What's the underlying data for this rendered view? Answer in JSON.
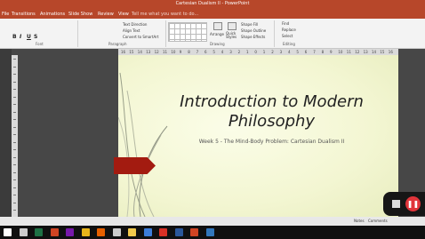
{
  "window": {
    "title": "Cartesian Dualism II - PowerPoint"
  },
  "tabs": [
    {
      "label": "File"
    },
    {
      "label": "Transitions"
    },
    {
      "label": "Animations"
    },
    {
      "label": "Slide Show"
    },
    {
      "label": "Review"
    },
    {
      "label": "View"
    }
  ],
  "tell_me": "Tell me what you want to do...",
  "ribbon": {
    "font_group": "Font",
    "paragraph_group": "Paragraph",
    "drawing_group": "Drawing",
    "editing_group": "Editing",
    "text_direction": "Text Direction",
    "align_text": "Align Text",
    "convert_smartart": "Convert to SmartArt",
    "arrange": "Arrange",
    "quick_styles": "Quick Styles",
    "shape_fill": "Shape Fill",
    "shape_outline": "Shape Outline",
    "shape_effects": "Shape Effects",
    "find": "Find",
    "replace": "Replace",
    "select": "Select",
    "bold": "B",
    "italic": "I",
    "underline": "U",
    "strike": "S"
  },
  "ruler": {
    "h_ticks": [
      "16",
      "15",
      "14",
      "13",
      "12",
      "11",
      "10",
      "9",
      "8",
      "7",
      "6",
      "5",
      "4",
      "3",
      "2",
      "1",
      "0",
      "1",
      "2",
      "3",
      "4",
      "5",
      "6",
      "7",
      "8",
      "9",
      "10",
      "11",
      "12",
      "13",
      "14",
      "15",
      "16"
    ]
  },
  "slide": {
    "title": "Introduction to Modern Philosophy",
    "subtitle": "Week 5 - The Mind-Body Problem: Cartesian Dualism II"
  },
  "status": {
    "notes": "Notes",
    "comments": "Comments"
  },
  "taskbar": {
    "icons": [
      {
        "name": "start-icon",
        "color": "#ffffff"
      },
      {
        "name": "search-icon",
        "color": "#cccccc"
      },
      {
        "name": "excel-icon",
        "color": "#1e7145"
      },
      {
        "name": "powerpoint-icon",
        "color": "#d04423"
      },
      {
        "name": "onenote-icon",
        "color": "#7719aa"
      },
      {
        "name": "chrome-icon",
        "color": "#e8b41a"
      },
      {
        "name": "firefox-icon",
        "color": "#e66000"
      },
      {
        "name": "settings-icon",
        "color": "#cccccc"
      },
      {
        "name": "file-explorer-icon",
        "color": "#f2c94c"
      },
      {
        "name": "app-icon",
        "color": "#3c7dd9"
      },
      {
        "name": "acrobat-icon",
        "color": "#d93025"
      },
      {
        "name": "word-icon",
        "color": "#2b579a"
      },
      {
        "name": "powerpoint-active-icon",
        "color": "#d04423"
      },
      {
        "name": "edge-icon",
        "color": "#3277bc"
      }
    ]
  }
}
